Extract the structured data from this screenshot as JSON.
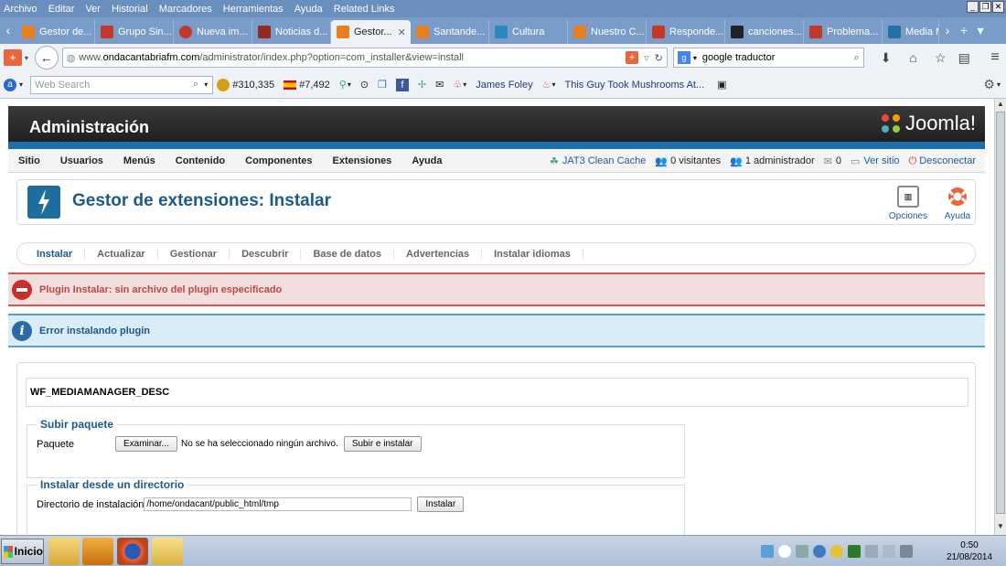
{
  "menubar": {
    "items": [
      "Archivo",
      "Editar",
      "Ver",
      "Historial",
      "Marcadores",
      "Herramientas",
      "Ayuda",
      "Related Links"
    ]
  },
  "tabs": [
    {
      "label": "Gestor de...",
      "color": "#e67e22"
    },
    {
      "label": "Grupo Sin...",
      "color": "#c0392b"
    },
    {
      "label": "Nueva im...",
      "color": "#c0392b"
    },
    {
      "label": "Noticias d...",
      "color": "#922b21"
    },
    {
      "label": "Gestor...",
      "color": "#e67e22"
    },
    {
      "label": "Santande...",
      "color": "#e67e22"
    },
    {
      "label": "Cultura",
      "color": "#2e86c1"
    },
    {
      "label": "Nuestro C...",
      "color": "#e67e22"
    },
    {
      "label": "Responde...",
      "color": "#c0392b"
    },
    {
      "label": "canciones...",
      "color": "#222222"
    },
    {
      "label": "Problema...",
      "color": "#c0392b"
    },
    {
      "label": "Media Ma",
      "color": "#2471a3"
    }
  ],
  "address": {
    "prefix": "www.",
    "domain": "ondacantabriafm.com",
    "path": "/administrator/index.php?option=com_installer&view=install"
  },
  "browser_search": {
    "value": "google traductor"
  },
  "toolbar2": {
    "web_search_placeholder": "Web Search",
    "count1": "#310,335",
    "count2": "#7,492",
    "user_link": "James Foley",
    "news_link": "This Guy Took Mushrooms At..."
  },
  "admin": {
    "title": "Administración",
    "logo_text": "Joomla!",
    "menu": [
      "Sitio",
      "Usuarios",
      "Menús",
      "Contenido",
      "Componentes",
      "Extensiones",
      "Ayuda"
    ],
    "status": {
      "cache": "JAT3 Clean Cache",
      "visitors": "0 visitantes",
      "admins": "1 administrador",
      "messages": "0",
      "view_site": "Ver sitio",
      "logout": "Desconectar"
    }
  },
  "page": {
    "title": "Gestor de extensiones: Instalar",
    "options_label": "Opciones",
    "help_label": "Ayuda"
  },
  "subnav": [
    "Instalar",
    "Actualizar",
    "Gestionar",
    "Descubrir",
    "Base de datos",
    "Advertencias",
    "Instalar idiomas"
  ],
  "messages": {
    "error": "Plugin Instalar: sin archivo del plugin especificado",
    "info": "Error instalando plugin"
  },
  "content": {
    "desc": "WF_MEDIAMANAGER_DESC",
    "upload": {
      "legend": "Subir paquete",
      "label": "Paquete",
      "browse_button": "Examinar...",
      "no_file": "No se ha seleccionado ningún archivo.",
      "submit_button": "Subir e instalar"
    },
    "directory": {
      "legend": "Instalar desde un directorio",
      "label": "Directorio de instalación",
      "value": "/home/ondacant/public_html/tmp",
      "submit_button": "Instalar"
    }
  },
  "taskbar": {
    "start_label": "Inicio",
    "time": "0:50",
    "date": "21/08/2014"
  },
  "colors": {
    "joomla_blue": "#1b6fae",
    "title_blue": "#1c5a8c",
    "error_red": "#b94a48",
    "info_blue": "#23538a"
  }
}
